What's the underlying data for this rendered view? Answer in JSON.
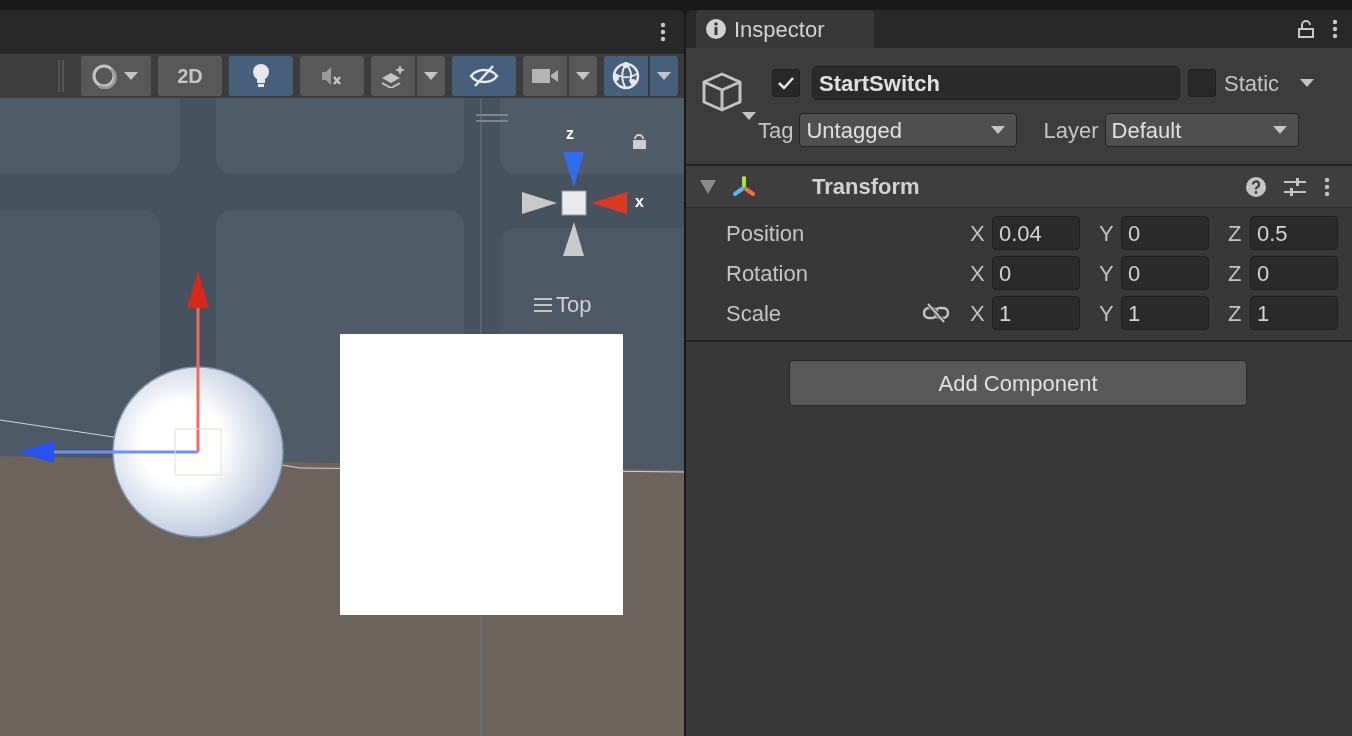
{
  "scene_toolbar": {
    "buttons": [
      {
        "kind": "shading",
        "dropdown": true,
        "selected": false
      },
      {
        "kind": "text",
        "label": "2D",
        "dropdown": false,
        "selected": false
      },
      {
        "kind": "light",
        "dropdown": false,
        "selected": true
      },
      {
        "kind": "audio",
        "dropdown": false,
        "selected": false
      },
      {
        "kind": "effects",
        "dropdown": true,
        "selected": false
      },
      {
        "kind": "visibility",
        "dropdown": false,
        "selected": true
      },
      {
        "kind": "camera",
        "dropdown": true,
        "selected": false
      },
      {
        "kind": "gizmos",
        "dropdown": true,
        "selected": true
      }
    ]
  },
  "scene": {
    "gizmo": {
      "axis_labels": [
        "z",
        "x"
      ],
      "view_label": "Top"
    }
  },
  "inspector": {
    "tab": {
      "title": "Inspector",
      "selected": true
    },
    "object": {
      "active": true,
      "name": "StartSwitch",
      "static": false,
      "static_label": "Static",
      "tag_label": "Tag",
      "tag": "Untagged",
      "layer_label": "Layer",
      "layer": "Default"
    },
    "components": [
      {
        "title": "Transform",
        "expanded": true,
        "rows": [
          {
            "label": "Position",
            "constrained": null,
            "values": [
              {
                "axis": "X",
                "value": "0.04"
              },
              {
                "axis": "Y",
                "value": "0"
              },
              {
                "axis": "Z",
                "value": "0.5"
              }
            ]
          },
          {
            "label": "Rotation",
            "constrained": null,
            "values": [
              {
                "axis": "X",
                "value": "0"
              },
              {
                "axis": "Y",
                "value": "0"
              },
              {
                "axis": "Z",
                "value": "0"
              }
            ]
          },
          {
            "label": "Scale",
            "constrained": false,
            "values": [
              {
                "axis": "X",
                "value": "1"
              },
              {
                "axis": "Y",
                "value": "1"
              },
              {
                "axis": "Z",
                "value": "1"
              }
            ]
          }
        ]
      }
    ],
    "add_button": "Add Component"
  }
}
